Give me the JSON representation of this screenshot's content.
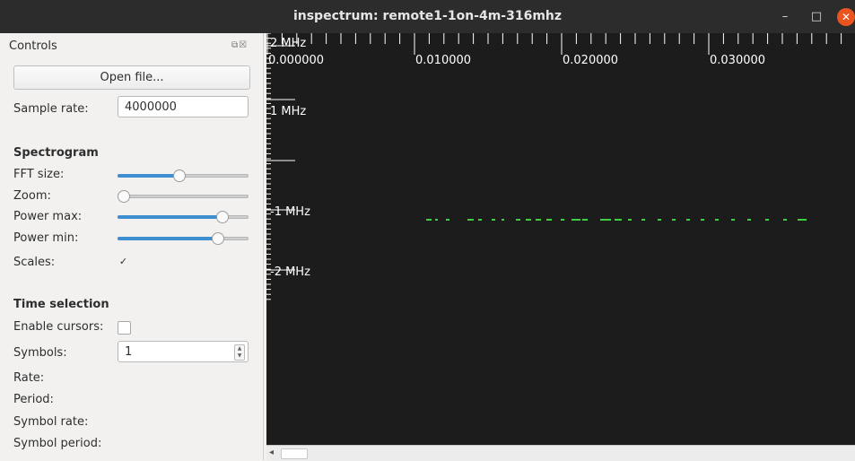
{
  "window": {
    "title": "inspectrum: remote1-1on-4m-316mhz"
  },
  "controls": {
    "dock_title": "Controls",
    "open_file_label": "Open file...",
    "sample_rate_label": "Sample rate:",
    "sample_rate_value": "4000000",
    "spectrogram_heading": "Spectrogram",
    "fft_size_label": "FFT size:",
    "fft_size_level": 0.47,
    "zoom_label": "Zoom:",
    "zoom_level": 0.0,
    "power_max_label": "Power max:",
    "power_max_level": 0.8,
    "power_min_label": "Power min:",
    "power_min_level": 0.77,
    "scales_label": "Scales:",
    "scales_checked": true,
    "time_heading": "Time selection",
    "enable_cursors_label": "Enable cursors:",
    "enable_cursors_checked": false,
    "symbols_label": "Symbols:",
    "symbols_value": "1",
    "rate_label": "Rate:",
    "period_label": "Period:",
    "symbol_rate_label": "Symbol rate:",
    "symbol_period_label": "Symbol period:"
  },
  "spectrogram": {
    "time_labels": [
      "0.000000",
      "0.010000",
      "0.020000",
      "0.030000"
    ],
    "freq_labels": [
      "2 MHz",
      "1 MHz",
      "-1 MHz",
      "-2 MHz"
    ],
    "signal_color": "#3ecf3e"
  }
}
